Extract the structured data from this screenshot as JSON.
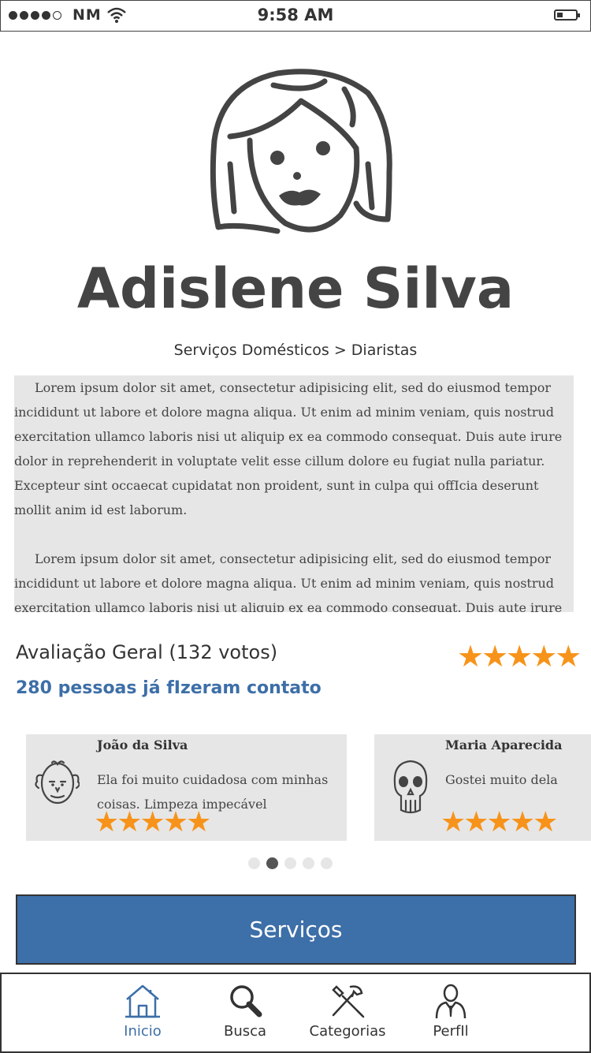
{
  "status_bar": {
    "carrier": "NM",
    "time": "9:58 AM",
    "signal_dots_filled": 4,
    "signal_dots_total": 5,
    "battery_level": 0.3
  },
  "profile": {
    "name": "Adislene Silva",
    "category": "Serviços Domésticos > Diaristas",
    "description": [
      "Lorem ipsum dolor sit amet, consectetur adipisicing elit, sed do eiusmod tempor incididunt ut labore et dolore magna aliqua. Ut enim ad minim veniam, quis nostrud exercitation ullamco laboris nisi ut aliquip ex ea commodo consequat. Duis aute irure dolor in reprehenderit in voluptate velit esse cillum dolore eu fugiat nulla pariatur. Excepteur sint occaecat cupidatat non proident, sunt in culpa qui offIcia deserunt mollit anim id est laborum.",
      "Lorem ipsum dolor sit amet, consectetur adipisicing elit, sed do eiusmod tempor incididunt ut labore et dolore magna aliqua. Ut enim ad minim veniam, quis nostrud exercitation ullamco laboris nisi ut aliquip ex ea commodo consequat. Duis aute irure dolor"
    ]
  },
  "rating": {
    "title": "Avaliação Geral (132 votos)",
    "stars": 5,
    "contacts_text": "280 pessoas já fIzeram contato"
  },
  "reviews": [
    {
      "name": "João da Silva",
      "text": "Ela foi muito cuidadosa com minhas coisas. Limpeza impecável",
      "stars": 5,
      "icon": "old-man-avatar-icon"
    },
    {
      "name": "Maria Aparecida",
      "text": "Gostei muito dela",
      "stars": 5,
      "icon": "skull-avatar-icon"
    }
  ],
  "pager": {
    "total": 5,
    "active_index": 1
  },
  "services_button": {
    "label": "Serviços"
  },
  "tabbar": {
    "items": [
      {
        "label": "Inicio",
        "icon": "home-icon",
        "active": true
      },
      {
        "label": "Busca",
        "icon": "search-icon",
        "active": false
      },
      {
        "label": "Categorias",
        "icon": "tools-icon",
        "active": false
      },
      {
        "label": "PerfIl",
        "icon": "person-icon",
        "active": false
      }
    ]
  },
  "colors": {
    "accent": "#3d6fa8",
    "star": "#f7931a",
    "panel": "#e6e6e6",
    "ink": "#444444"
  }
}
